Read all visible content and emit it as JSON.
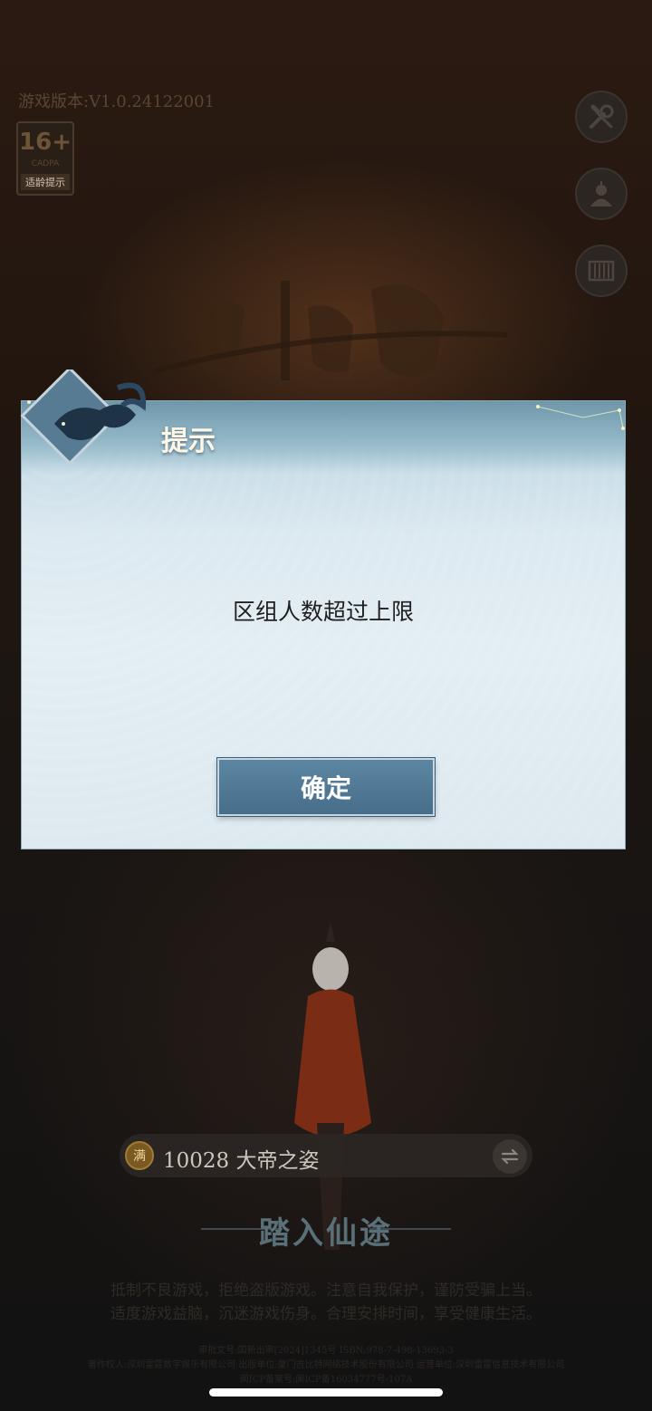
{
  "app": {
    "version_text": "游戏版本:V1.0.24122001",
    "age_rating": {
      "number": "16+",
      "org": "CADPA",
      "tip": "适龄提示"
    }
  },
  "side_buttons": [
    {
      "icon": "wrench-screwdriver-icon"
    },
    {
      "icon": "account-icon"
    },
    {
      "icon": "scroll-icon"
    }
  ],
  "dialog": {
    "title": "提示",
    "message": "区组人数超过上限",
    "confirm_label": "确定"
  },
  "server": {
    "badge": "满",
    "name": "10028 大帝之姿"
  },
  "enter_label": "踏入仙途",
  "health_notice": [
    "抵制不良游戏，拒绝盗版游戏。注意自我保护，谨防受骗上当。",
    "适度游戏益脑，沉迷游戏伤身。合理安排时间，享受健康生活。"
  ],
  "small_print": [
    "审批文号:国新出审[2024]1345号 ISBN:978-7-498-13693-3",
    "著作权人:深圳雷霆数字娱乐有限公司 出版单位:厦门吉比特网络技术股份有限公司 运营单位:深圳雷霆信息技术有限公司",
    "闽ICP备案号:闽ICP备16034777号-107A"
  ],
  "colors": {
    "dialog_button": "#4f7893",
    "dialog_title": "#fff7e6",
    "background": "#1b1714"
  }
}
